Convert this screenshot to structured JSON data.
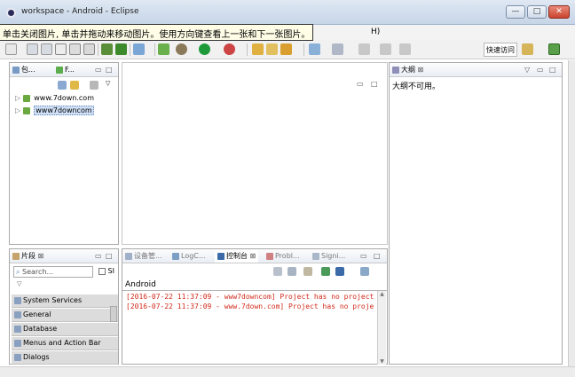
{
  "window": {
    "title": "workspace - Android - Eclipse",
    "minimize": "—",
    "maximize": "□",
    "close": "✕"
  },
  "tooltip": "单击关闭图片, 单击并拖动来移动图片。使用方向键查看上一张和下一张图片。",
  "menu": {
    "help": "H)"
  },
  "toolbar": {
    "quick_access": "快速访问"
  },
  "left_panel": {
    "tabs": [
      "包...",
      "F..."
    ],
    "tree": [
      "www.7down.com",
      "www7downcom"
    ]
  },
  "outline_panel": {
    "tab": "大纲",
    "message": "大纲不可用。"
  },
  "snippets_panel": {
    "tab": "片段",
    "search_placeholder": "Search...",
    "checkbox_label": "SI",
    "items": [
      "System Services",
      "General",
      "Database",
      "Menus and Action Bar",
      "Dialogs"
    ]
  },
  "console_panel": {
    "tabs": [
      "设备管...",
      "LogC...",
      "控制台",
      "Probl...",
      "Signi..."
    ],
    "heading": "Android",
    "lines": [
      "[2016-07-22 11:37:09 - www7downcom] Project has no project",
      "[2016-07-22 11:37:09 - www.7down.com] Project has no proje"
    ]
  },
  "colors": {
    "log_error": "#d12b1b",
    "selection": "#cfe0f7"
  }
}
